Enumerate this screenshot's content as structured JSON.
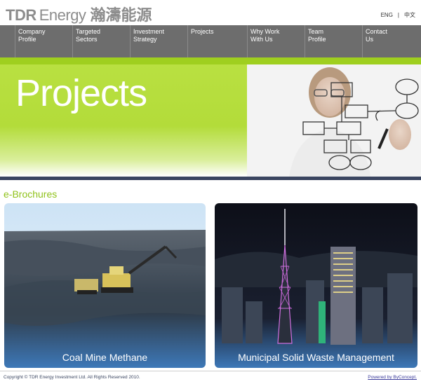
{
  "logo": {
    "en_bold": "TDR",
    "en": "Energy",
    "zh": "瀚濤能源"
  },
  "lang": {
    "eng": "ENG",
    "sep": "|",
    "zh": "中文"
  },
  "nav": [
    {
      "label": "Company\nProfile"
    },
    {
      "label": "Targeted\nSectors"
    },
    {
      "label": "Investment\nStrategy"
    },
    {
      "label": "Projects"
    },
    {
      "label": "Why Work\nWith Us"
    },
    {
      "label": "Team\nProfile"
    },
    {
      "label": "Contact\nUs"
    }
  ],
  "banner": {
    "title": "Projects"
  },
  "section": {
    "title": "e-Brochures"
  },
  "brochures": [
    {
      "caption": "Coal Mine Methane"
    },
    {
      "caption": "Municipal Solid Waste Management"
    }
  ],
  "footer": {
    "copyright": "Copyright © TDR Energy Investment Ltd. All Rights Reserved 2010.",
    "powered": "Powered by ByConcept."
  },
  "colors": {
    "accent_green": "#9fcf1f",
    "nav_gray": "#6d6d6d",
    "footer_navy": "#3a4560"
  }
}
